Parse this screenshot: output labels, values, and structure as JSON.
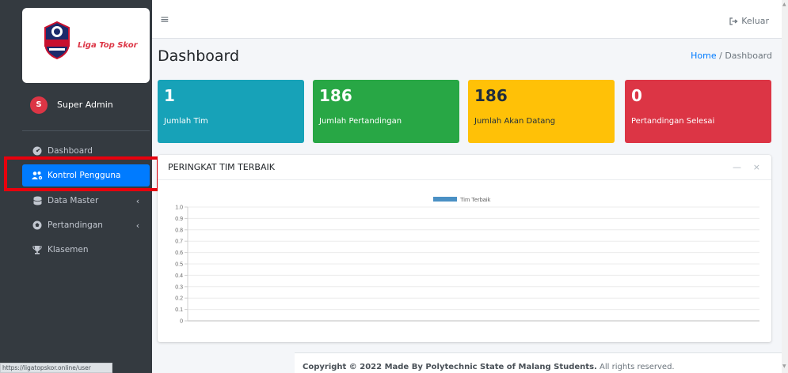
{
  "sidebar": {
    "brand_name": "Liga Top Skor",
    "logo_text": "LIGA TOPSKOR",
    "user": {
      "initial": "S",
      "name": "Super Admin"
    },
    "items": [
      {
        "label": "Dashboard",
        "icon": "tachometer-icon",
        "has_children": false
      },
      {
        "label": "Kontrol Pengguna",
        "icon": "users-cog-icon",
        "has_children": false,
        "active": true
      },
      {
        "label": "Data Master",
        "icon": "database-icon",
        "has_children": true
      },
      {
        "label": "Pertandingan",
        "icon": "futbol-icon",
        "has_children": true
      },
      {
        "label": "Klasemen",
        "icon": "trophy-icon",
        "has_children": false
      }
    ]
  },
  "navbar": {
    "menu_icon": "≡",
    "logout_label": "Keluar"
  },
  "header": {
    "title": "Dashboard",
    "breadcrumb_home": "Home",
    "breadcrumb_sep": "/",
    "breadcrumb_current": "Dashboard"
  },
  "stats": [
    {
      "value": "1",
      "label": "Jumlah Tim",
      "color": "#17a2b8"
    },
    {
      "value": "186",
      "label": "Jumlah Pertandingan",
      "color": "#28a745"
    },
    {
      "value": "186",
      "label": "Jumlah Akan Datang",
      "color": "#ffc107"
    },
    {
      "value": "0",
      "label": "Pertandingan Selesai",
      "color": "#dc3545"
    }
  ],
  "chart_card": {
    "title": "PERINGKAT TIM TERBAIK",
    "minimize_icon": "—",
    "close_icon": "×"
  },
  "chart_data": {
    "type": "bar",
    "categories": [],
    "series": [
      {
        "name": "Tim Terbaik",
        "values": [],
        "color": "#4a90c4"
      }
    ],
    "ylim": [
      0,
      1.0
    ],
    "yticks": [
      "0",
      "0.1",
      "0.2",
      "0.3",
      "0.4",
      "0.5",
      "0.6",
      "0.7",
      "0.8",
      "0.9",
      "1.0"
    ],
    "grid": true,
    "legend": "top-center"
  },
  "footer": {
    "bold": "Copyright © 2022 Made By Polytechnic State of Malang Students.",
    "rest": " All rights reserved."
  },
  "status_url": "https://ligatopskor.online/user"
}
